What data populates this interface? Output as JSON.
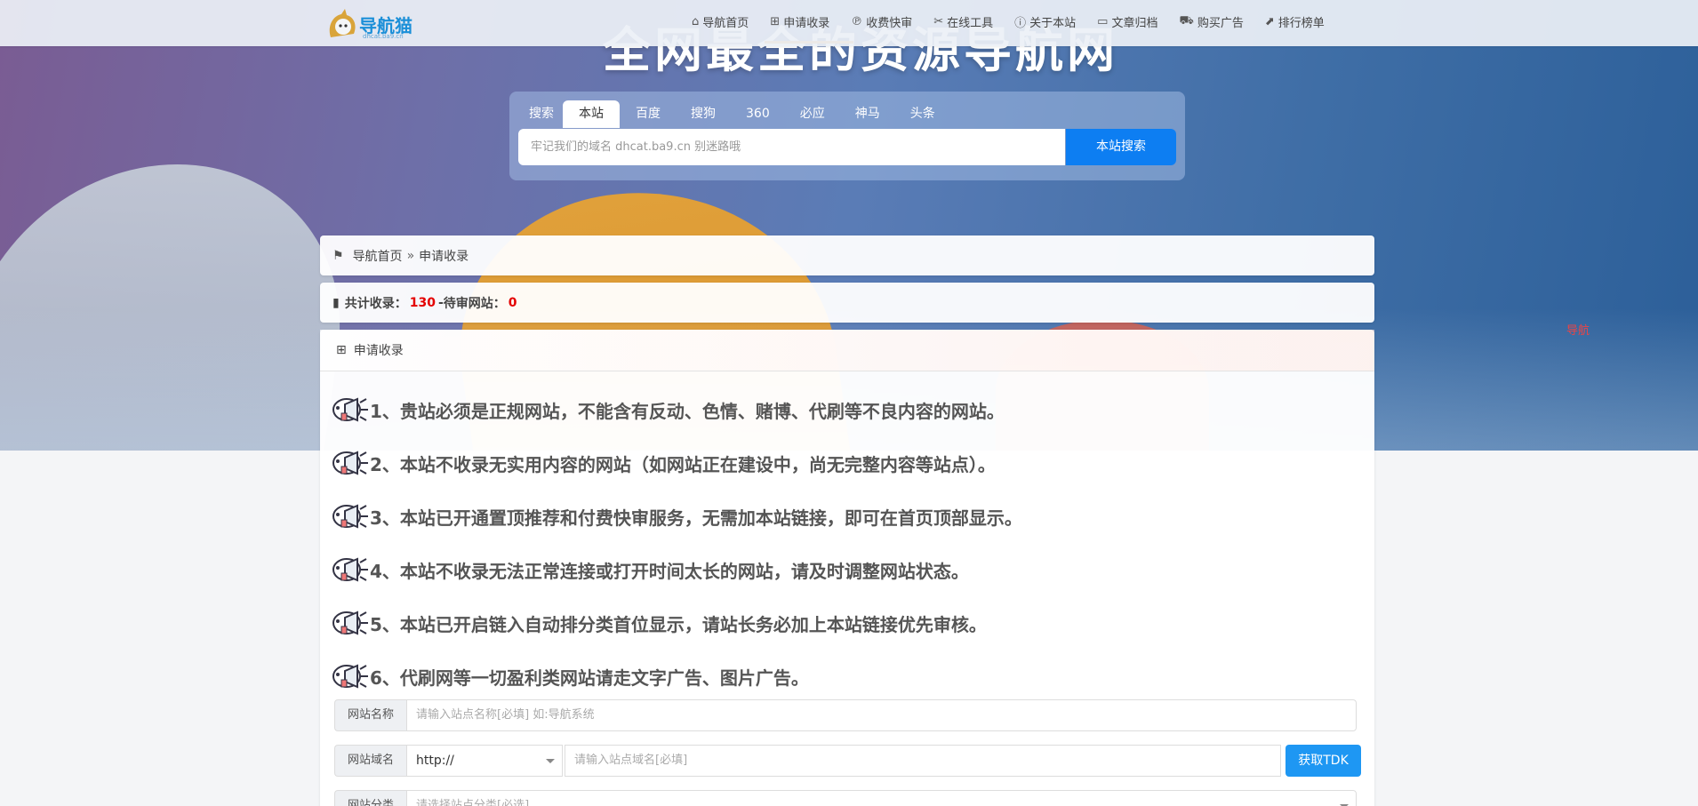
{
  "colors": {
    "accent": "#0d7ef2",
    "highlight_number": "#e40000",
    "nav_bg": "#ecf0f6",
    "button_tdk": "#1e97f3"
  },
  "logo": {
    "text": "导航猫",
    "sub": "dhcat.ba9.cn"
  },
  "nav": [
    {
      "icon": "home-icon",
      "label": "导航首页"
    },
    {
      "icon": "plus-square-icon",
      "label": "申请收录"
    },
    {
      "icon": "paypal-icon",
      "label": "收费快审"
    },
    {
      "icon": "tools-icon",
      "label": "在线工具"
    },
    {
      "icon": "info-circle-icon",
      "label": "关于本站"
    },
    {
      "icon": "folder-open-icon",
      "label": "文章归档"
    },
    {
      "icon": "cart-icon",
      "label": "购买广告"
    },
    {
      "icon": "line-chart-icon",
      "label": "排行榜单"
    }
  ],
  "hero": {
    "title": "全网最全的资源导航网",
    "side_link": "导航"
  },
  "search": {
    "tabs": [
      "搜索",
      "本站",
      "百度",
      "搜狗",
      "360",
      "必应",
      "神马",
      "头条"
    ],
    "active_tab": "本站",
    "placeholder": "牢记我们的域名 dhcat.ba9.cn 别迷路哦",
    "button": "本站搜索"
  },
  "breadcrumb": {
    "home": "导航首页",
    "separator": "»",
    "current": "申请收录"
  },
  "stats": {
    "label_total": "共计收录：",
    "total": "130",
    "dash": " - ",
    "label_pending": "待审网站：",
    "pending": "0"
  },
  "main": {
    "title": "申请收录",
    "rules": [
      "1、贵站必须是正规网站，不能含有反动、色情、赌博、代刷等不良内容的网站。",
      "2、本站不收录无实用内容的网站（如网站正在建设中，尚无完整内容等站点）。",
      "3、本站已开通置顶推荐和付费快审服务，无需加本站链接，即可在首页顶部显示。",
      "4、本站不收录无法正常连接或打开时间太长的网站，请及时调整网站状态。",
      "5、本站已开启链入自动排分类首位显示，请站长务必加上本站链接优先审核。",
      "6、代刷网等一切盈利类网站请走文字广告、图片广告。"
    ]
  },
  "form": {
    "name_label": "网站名称",
    "name_placeholder": "请输入站点名称[必填] 如:导航系统",
    "domain_label": "网站域名",
    "protocol_value": "http://",
    "domain_placeholder": "请输入站点域名[必填]",
    "tdk_button": "获取TDK",
    "category_label": "网站分类",
    "category_placeholder": "请选择站点分类[必选]"
  }
}
